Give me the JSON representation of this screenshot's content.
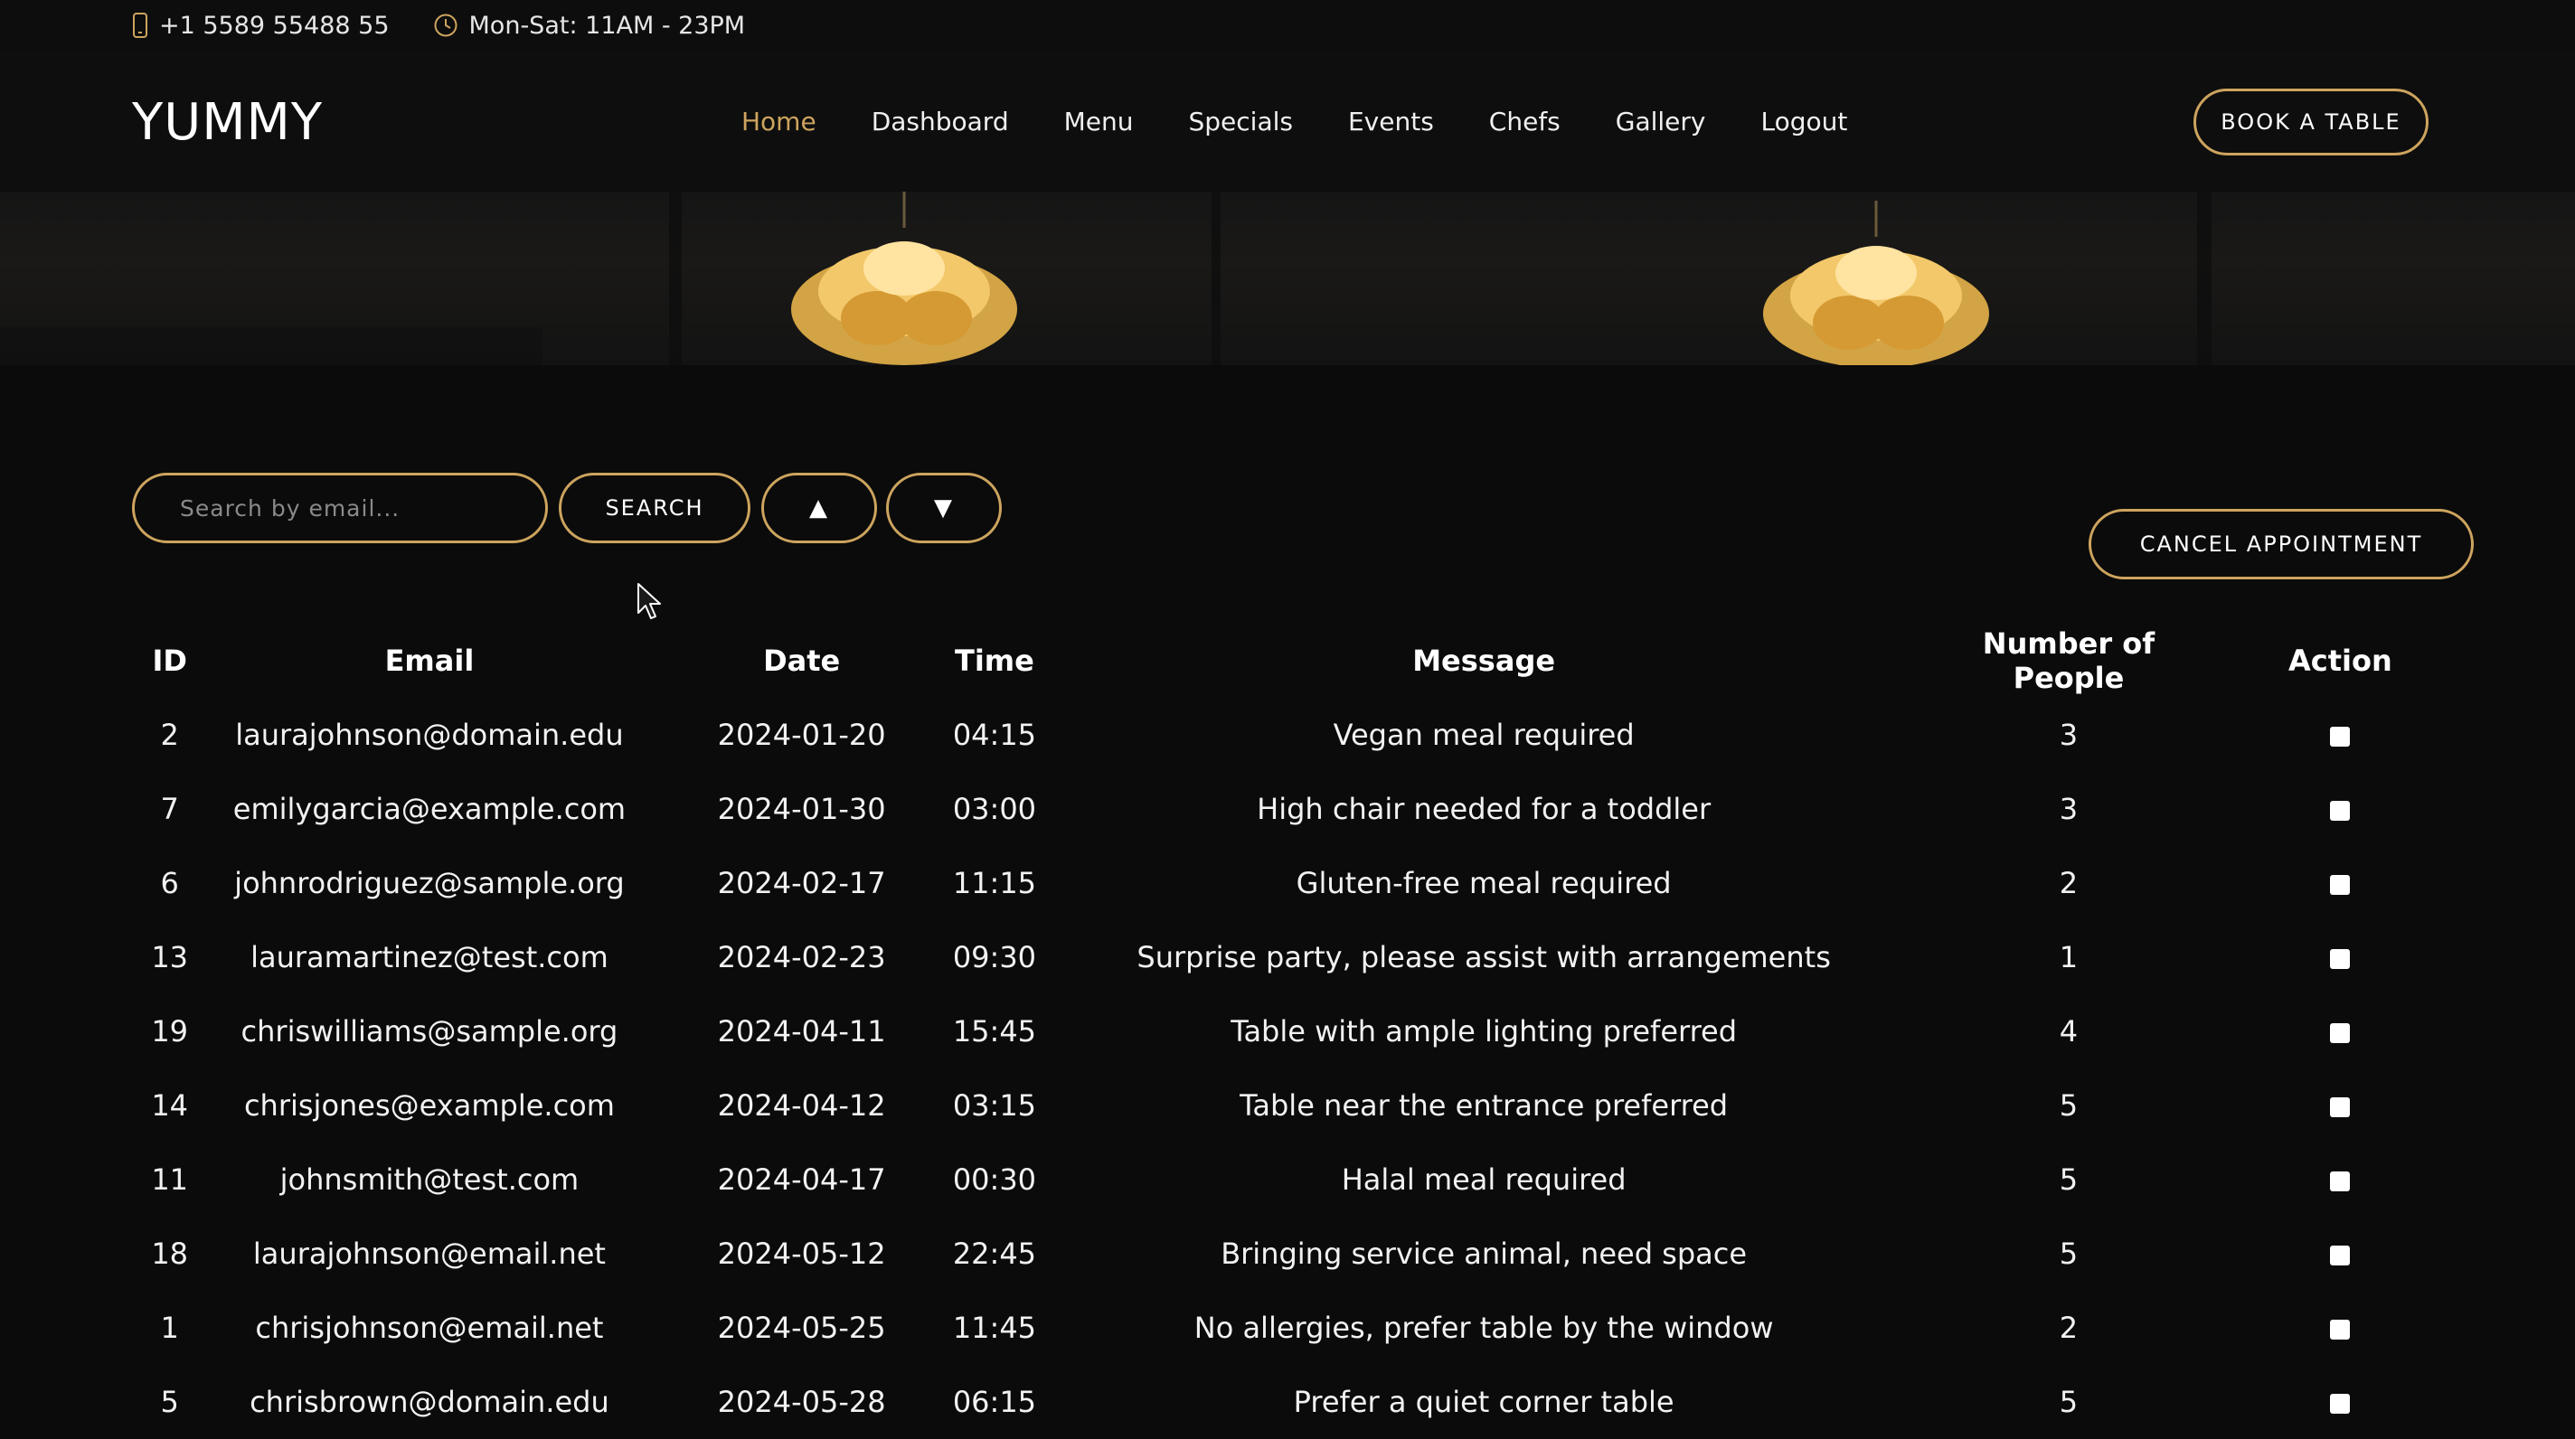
{
  "topbar": {
    "phone": "+1 5589 55488 55",
    "hours": "Mon-Sat: 11AM - 23PM"
  },
  "header": {
    "logo": "YUMMY",
    "nav": [
      {
        "label": "Home",
        "active": true
      },
      {
        "label": "Dashboard"
      },
      {
        "label": "Menu"
      },
      {
        "label": "Specials"
      },
      {
        "label": "Events"
      },
      {
        "label": "Chefs"
      },
      {
        "label": "Gallery"
      },
      {
        "label": "Logout"
      }
    ],
    "book_label": "BOOK A TABLE"
  },
  "controls": {
    "search_placeholder": "Search by email...",
    "search_label": "SEARCH",
    "sort_up_label": "▲",
    "sort_down_label": "▼",
    "cancel_label": "CANCEL APPOINTMENT"
  },
  "colors": {
    "accent": "#cda45e",
    "background": "#0b0b0b"
  },
  "table": {
    "headers": [
      "ID",
      "Email",
      "Date",
      "Time",
      "Message",
      "Number of People",
      "Action"
    ],
    "rows": [
      {
        "id": "2",
        "email": "laurajohnson@domain.edu",
        "date": "2024-01-20",
        "time": "04:15",
        "message": "Vegan meal required",
        "people": "3"
      },
      {
        "id": "7",
        "email": "emilygarcia@example.com",
        "date": "2024-01-30",
        "time": "03:00",
        "message": "High chair needed for a toddler",
        "people": "3"
      },
      {
        "id": "6",
        "email": "johnrodriguez@sample.org",
        "date": "2024-02-17",
        "time": "11:15",
        "message": "Gluten-free meal required",
        "people": "2"
      },
      {
        "id": "13",
        "email": "lauramartinez@test.com",
        "date": "2024-02-23",
        "time": "09:30",
        "message": "Surprise party, please assist with arrangements",
        "people": "1"
      },
      {
        "id": "19",
        "email": "chriswilliams@sample.org",
        "date": "2024-04-11",
        "time": "15:45",
        "message": "Table with ample lighting preferred",
        "people": "4"
      },
      {
        "id": "14",
        "email": "chrisjones@example.com",
        "date": "2024-04-12",
        "time": "03:15",
        "message": "Table near the entrance preferred",
        "people": "5"
      },
      {
        "id": "11",
        "email": "johnsmith@test.com",
        "date": "2024-04-17",
        "time": "00:30",
        "message": "Halal meal required",
        "people": "5"
      },
      {
        "id": "18",
        "email": "laurajohnson@email.net",
        "date": "2024-05-12",
        "time": "22:45",
        "message": "Bringing service animal, need space",
        "people": "5"
      },
      {
        "id": "1",
        "email": "chrisjohnson@email.net",
        "date": "2024-05-25",
        "time": "11:45",
        "message": "No allergies, prefer table by the window",
        "people": "2"
      },
      {
        "id": "5",
        "email": "chrisbrown@domain.edu",
        "date": "2024-05-28",
        "time": "06:15",
        "message": "Prefer a quiet corner table",
        "people": "5"
      }
    ]
  }
}
